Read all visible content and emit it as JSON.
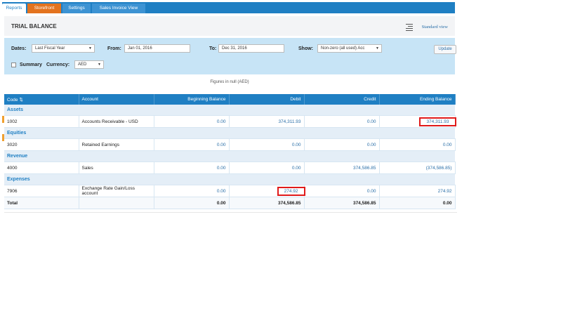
{
  "tabs": [
    {
      "label": "Reports"
    },
    {
      "label": "Storefront"
    },
    {
      "label": "Settings"
    },
    {
      "label": "Sales Invoice View"
    }
  ],
  "header": {
    "title": "TRIAL BALANCE",
    "standard_view": "Standard view"
  },
  "filters": {
    "dates_label": "Dates:",
    "dates_value": "Last Fiscal Year",
    "from_label": "From:",
    "from_value": "Jan 01, 2016",
    "to_label": "To:",
    "to_value": "Dec 31, 2016",
    "show_label": "Show:",
    "show_value": "Non-zero (all used) Acc",
    "update_label": "Update",
    "summary_label": "Summary",
    "currency_label": "Currency:",
    "currency_value": "AED"
  },
  "figures_note": "Figures in null (AED)",
  "table": {
    "headers": {
      "code": "Code",
      "sort_icon": "⇅",
      "account": "Account",
      "beginning": "Beginning Balance",
      "debit": "Debit",
      "credit": "Credit",
      "ending": "Ending Balance"
    },
    "groups": [
      {
        "name": "Assets",
        "rows": [
          {
            "code": "1002",
            "account": "Accounts Receivable - USD",
            "beginning": "0.00",
            "debit": "374,311.93",
            "credit": "0.00",
            "ending": "374,311.93"
          }
        ]
      },
      {
        "name": "Equities",
        "rows": [
          {
            "code": "3020",
            "account": "Retained Earnings",
            "beginning": "0.00",
            "debit": "0.00",
            "credit": "0.00",
            "ending": "0.00"
          }
        ]
      },
      {
        "name": "Revenue",
        "rows": [
          {
            "code": "4000",
            "account": "Sales",
            "beginning": "0.00",
            "debit": "0.00",
            "credit": "374,586.85",
            "ending": "(374,586.85)"
          }
        ]
      },
      {
        "name": "Expenses",
        "rows": [
          {
            "code": "7906",
            "account": "Exchange Rate Gain/Loss account",
            "beginning": "0.00",
            "debit": "274.92",
            "credit": "0.00",
            "ending": "274.92"
          }
        ]
      }
    ],
    "total": {
      "label": "Total",
      "beginning": "0.00",
      "debit": "374,586.85",
      "credit": "374,586.85",
      "ending": "0.00"
    }
  },
  "colors": {
    "tab_blue": "#1f7fc3",
    "storefront_orange": "#e3731f",
    "filter_bg": "#c7e4f6",
    "highlight_red": "#e01a1a"
  }
}
